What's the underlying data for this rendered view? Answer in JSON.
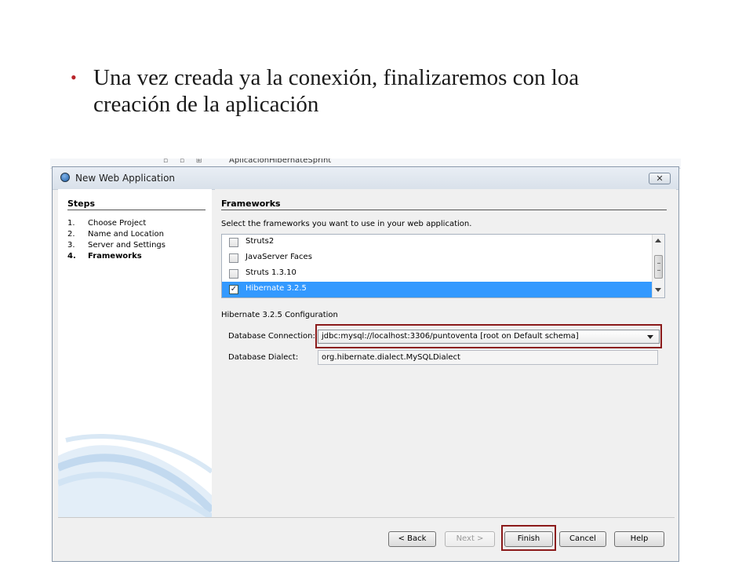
{
  "slide": {
    "bullet": "•",
    "text": "Una vez creada ya la conexión, finalizaremos con loa creación de la aplicación"
  },
  "background_ide": {
    "partial_title": "AplicacionHibernateSprint"
  },
  "dialog": {
    "title": "New Web Application",
    "close_glyph": "✕",
    "steps": {
      "heading": "Steps",
      "items": [
        {
          "num": "1.",
          "label": "Choose Project"
        },
        {
          "num": "2.",
          "label": "Name and Location"
        },
        {
          "num": "3.",
          "label": "Server and Settings"
        },
        {
          "num": "4.",
          "label": "Frameworks",
          "active": true
        }
      ]
    },
    "frameworks": {
      "heading": "Frameworks",
      "instruction": "Select the frameworks you want to use in your web application.",
      "items": [
        {
          "label": "Struts2",
          "checked": false
        },
        {
          "label": "JavaServer Faces",
          "checked": false
        },
        {
          "label": "Struts 1.3.10",
          "checked": false
        },
        {
          "label": "Hibernate 3.2.5",
          "checked": true,
          "selected": true
        }
      ],
      "check_glyph": "✓"
    },
    "config": {
      "heading": "Hibernate 3.2.5 Configuration",
      "connection_label": "Database Connection:",
      "connection_value": "jdbc:mysql://localhost:3306/puntoventa [root on Default schema]",
      "dialect_label": "Database Dialect:",
      "dialect_value": "org.hibernate.dialect.MySQLDialect"
    },
    "buttons": {
      "back": "< Back",
      "next": "Next >",
      "finish": "Finish",
      "cancel": "Cancel",
      "help": "Help"
    }
  },
  "colors": {
    "selection": "#3399ff",
    "highlight_border": "#8b1a1a",
    "bullet": "#b8242a"
  }
}
